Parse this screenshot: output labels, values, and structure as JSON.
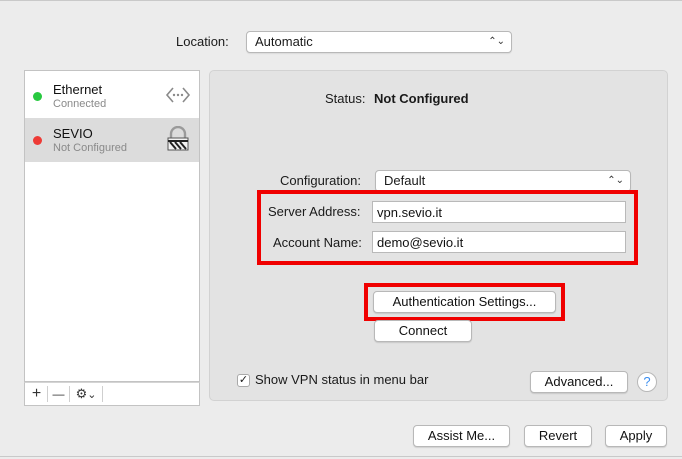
{
  "location": {
    "label": "Location:",
    "value": "Automatic"
  },
  "services": [
    {
      "name": "Ethernet",
      "status": "Connected",
      "status_color": "#28c940",
      "icon": "ethernet-arrows-icon"
    },
    {
      "name": "SEVIO",
      "status": "Not Configured",
      "status_color": "#ee3b36",
      "icon": "vpn-lock-icon"
    }
  ],
  "sidebar_toolbar": {
    "add": "+",
    "remove": "—",
    "action": "⚙",
    "menu": "⌄"
  },
  "status": {
    "label": "Status:",
    "value": "Not Configured"
  },
  "configuration": {
    "label": "Configuration:",
    "value": "Default"
  },
  "server_address": {
    "label": "Server Address:",
    "value": "vpn.sevio.it"
  },
  "account_name": {
    "label": "Account Name:",
    "value": "demo@sevio.it"
  },
  "buttons": {
    "auth_settings": "Authentication Settings...",
    "connect": "Connect",
    "advanced": "Advanced...",
    "help": "?",
    "assist": "Assist Me...",
    "revert": "Revert",
    "apply": "Apply"
  },
  "show_vpn_status": {
    "label": "Show VPN status in menu bar",
    "checked": true,
    "mark": "✓"
  },
  "highlight_color": "#f00000"
}
